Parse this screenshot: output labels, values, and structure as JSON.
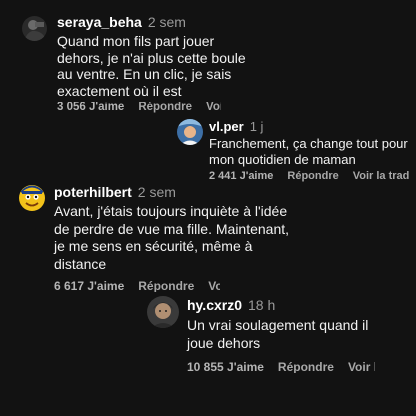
{
  "comments": [
    {
      "username": "seraya_beha",
      "time": "2 sem",
      "text": "Quand mon fils part jouer dehors, je n'ai plus cette boule au ventre. En un clic, je sais exactement où il est",
      "likes": "3 056 J'aime",
      "reply_label": "Répondre",
      "translate_label": "Voir la tra"
    },
    {
      "username": "vl.per",
      "time": "1 j",
      "text": "Franchement, ça change tout pour mon quotidien de maman",
      "likes": "2 441 J'aime",
      "reply_label": "Répondre",
      "translate_label": "Voir la trad"
    },
    {
      "username": "poterhilbert",
      "time": "2 sem",
      "text": "Avant, j'étais toujours inquiète à l'idée de perdre de vue ma fille. Maintenant, je me sens en sécurité, même à distance",
      "likes": "6 617 J'aime",
      "reply_label": "Répondre",
      "translate_label": "Voir la tradu"
    },
    {
      "username": "hy.cxrz0",
      "time": "18 h",
      "text": "Un vrai soulagement quand il joue dehors",
      "likes": "10 855 J'aime",
      "reply_label": "Répondre",
      "translate_label": "Voir la tr"
    }
  ],
  "colors": {
    "background": "#121212",
    "text": "#ffffff",
    "muted": "#9a9a9a"
  },
  "icons": [
    "avatar-seraya",
    "avatar-vlper",
    "avatar-poterhilbert-emoji",
    "avatar-hycxrz0"
  ]
}
